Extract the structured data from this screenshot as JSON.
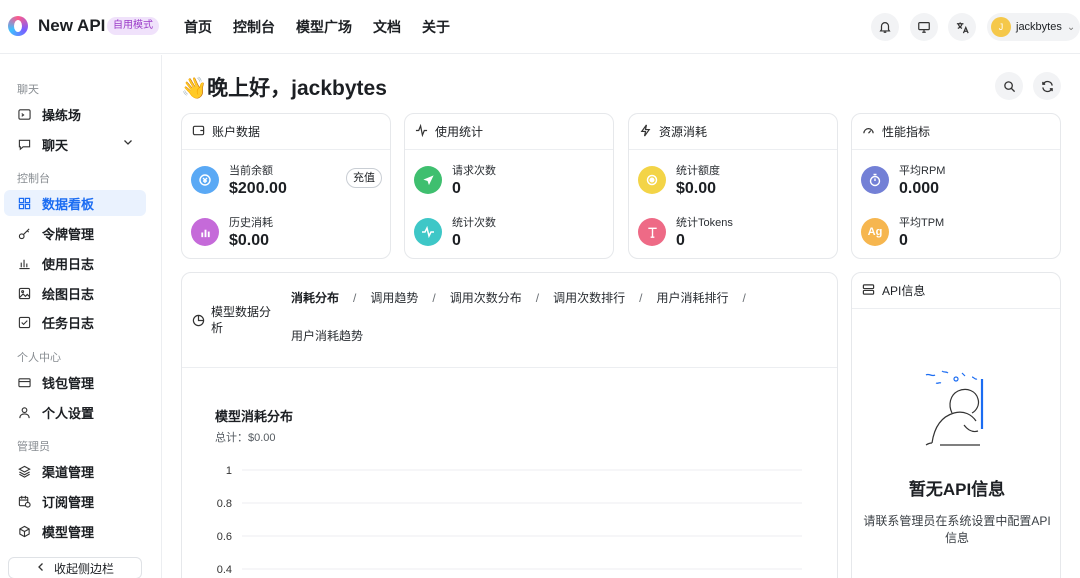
{
  "header": {
    "brand": "New API",
    "mode_badge": "自用模式",
    "nav": [
      "首页",
      "控制台",
      "模型广场",
      "文档",
      "关于"
    ],
    "user": {
      "initial": "J",
      "name": "jackbytes"
    }
  },
  "sidebar": {
    "sections": {
      "chat": "聊天",
      "console": "控制台",
      "personal": "个人中心",
      "admin": "管理员"
    },
    "items": {
      "playground": "操练场",
      "chat": "聊天",
      "dashboard": "数据看板",
      "tokens": "令牌管理",
      "usage_log": "使用日志",
      "drawing_log": "绘图日志",
      "task_log": "任务日志",
      "wallet": "钱包管理",
      "settings": "个人设置",
      "channels": "渠道管理",
      "subscriptions": "订阅管理",
      "models": "模型管理"
    },
    "collapse_label": "收起侧边栏"
  },
  "main": {
    "greeting": "👋晚上好，jackbytes",
    "cards": {
      "account": {
        "title": "账户数据",
        "balance_label": "当前余额",
        "balance_value": "$200.00",
        "recharge": "充值",
        "spent_label": "历史消耗",
        "spent_value": "$0.00"
      },
      "usage": {
        "title": "使用统计",
        "requests_label": "请求次数",
        "requests_value": "0",
        "count_label": "统计次数",
        "count_value": "0"
      },
      "resource": {
        "title": "资源消耗",
        "quota_label": "统计额度",
        "quota_value": "$0.00",
        "tokens_label": "统计Tokens",
        "tokens_value": "0"
      },
      "performance": {
        "title": "性能指标",
        "rpm_label": "平均RPM",
        "rpm_value": "0.000",
        "tpm_label": "平均TPM",
        "tpm_value": "0",
        "tpm_icon_text": "Ag"
      }
    },
    "analysis": {
      "title": "模型数据分析",
      "tabs": [
        "消耗分布",
        "调用趋势",
        "调用次数分布",
        "调用次数排行",
        "用户消耗排行",
        "用户消耗趋势"
      ],
      "separator": "/"
    },
    "api_info": {
      "title": "API信息",
      "empty_title": "暂无API信息",
      "empty_desc": "请联系管理员在系统设置中配置API信息"
    }
  },
  "chart_data": {
    "type": "bar",
    "title": "模型消耗分布",
    "subtitle": "总计：$0.00",
    "categories": [],
    "values": [],
    "y_ticks": [
      "1",
      "0.8",
      "0.6",
      "0.4"
    ],
    "ylim": [
      0,
      1
    ],
    "grid": true
  },
  "colors": {
    "accent": "#1b6cf2",
    "balance_icon": "#5aa9f5",
    "spent_icon": "#c56ad9",
    "requests_icon": "#3fbf6f",
    "count_icon": "#3ec7c7",
    "quota_icon": "#f3d447",
    "tokens_icon": "#ee6a86",
    "rpm_icon": "#7380d6",
    "tpm_icon": "#f6b64f"
  }
}
